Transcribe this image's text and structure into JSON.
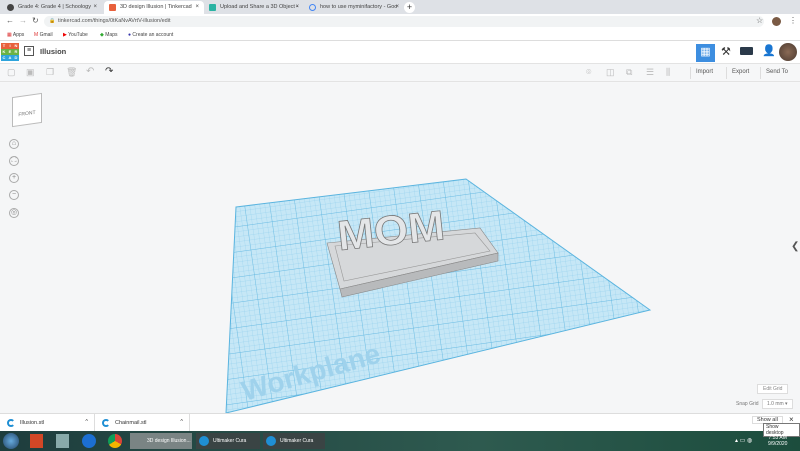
{
  "browser": {
    "tabs": [
      {
        "label": "Grade 4: Grade 4 | Schoology",
        "active": false
      },
      {
        "label": "3D design Illusion | Tinkercad",
        "active": true
      },
      {
        "label": "Upload and Share a 3D Object -",
        "active": false
      },
      {
        "label": "how to use myminifactory - Goo",
        "active": false
      }
    ],
    "new_tab": "+",
    "url": "tinkercad.com/things/0tKaNvAVrtV-illusion/edit",
    "bookmarks": [
      "Apps",
      "Gmail",
      "YouTube",
      "Maps",
      "Create an account"
    ]
  },
  "app": {
    "logo": [
      "T",
      "I",
      "N",
      "K",
      "E",
      "R",
      "C",
      "A",
      "D"
    ],
    "design_name": "Illusion",
    "toolbar": {
      "import": "Import",
      "export": "Export",
      "send_to": "Send To"
    },
    "view_cube": "FRONT",
    "workplane_label": "Workplane",
    "model_text": "MOM",
    "edit_grid": "Edit Grid",
    "snap_grid_label": "Snap Grid",
    "snap_grid_value": "1.0 mm"
  },
  "downloads": {
    "items": [
      "Illusion.stl",
      "Chainmail.stl"
    ],
    "show_all": "Show all",
    "tooltip": "Show desktop"
  },
  "taskbar": {
    "items": [
      "3D design Illusion...",
      "Ultimaker Cura",
      "Ultimaker Cura"
    ],
    "time": "7:53 AM",
    "date": "9/9/2020"
  },
  "colors": {
    "accent": "#3d8ee0",
    "workplane": "#b9dff2",
    "grid": "#6fc1e6"
  }
}
